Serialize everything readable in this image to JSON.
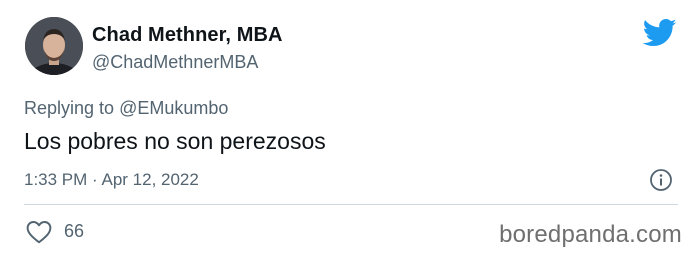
{
  "tweet": {
    "author": {
      "display_name": "Chad Methner, MBA",
      "handle": "@ChadMethnerMBA"
    },
    "reply_prefix": "Replying to",
    "reply_to": "@EMukumbo",
    "text": "Los pobres no son perezosos",
    "timestamp": "1:33 PM · Apr 12, 2022",
    "likes": "66"
  },
  "watermark": "boredpanda.com",
  "colors": {
    "twitter_blue": "#1d9bf0",
    "secondary_text": "#536471",
    "primary_text": "#0f1419",
    "divider": "#cfd9de"
  },
  "icons": {
    "platform": "twitter-bird-icon",
    "info": "info-icon",
    "like": "heart-icon"
  }
}
